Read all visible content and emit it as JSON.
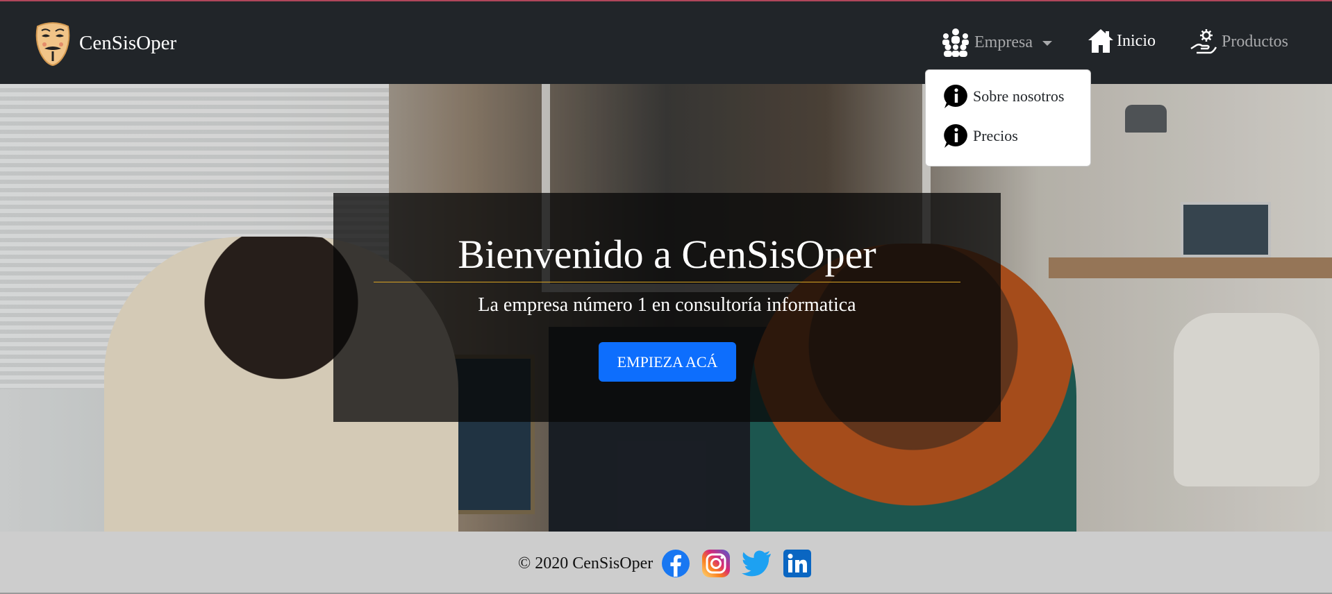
{
  "brand": {
    "name": "CenSisOper",
    "logo_icon": "anonymous-mask-icon"
  },
  "nav": {
    "empresa": {
      "label": "Empresa",
      "icon": "team-icon"
    },
    "inicio": {
      "label": "Inicio",
      "icon": "house-icon"
    },
    "productos": {
      "label": "Productos",
      "icon": "hand-gear-icon"
    }
  },
  "dropdown": {
    "items": [
      {
        "label": "Sobre nosotros",
        "icon": "info-icon"
      },
      {
        "label": "Precios",
        "icon": "info-icon"
      }
    ]
  },
  "hero": {
    "title": "Bienvenido a CenSisOper",
    "subtitle": "La empresa número 1 en consultoría informatica",
    "cta_label": "EMPIEZA ACÁ",
    "background_icon": "office-photo"
  },
  "footer": {
    "copyright": "© 2020 CenSisOper",
    "social": [
      "facebook-icon",
      "instagram-icon",
      "twitter-icon",
      "linkedin-icon"
    ]
  },
  "colors": {
    "navbar": "#212529",
    "accent_blue": "#0d6efd",
    "rule_gold": "#d9a423",
    "footer": "#cdcdcd"
  }
}
